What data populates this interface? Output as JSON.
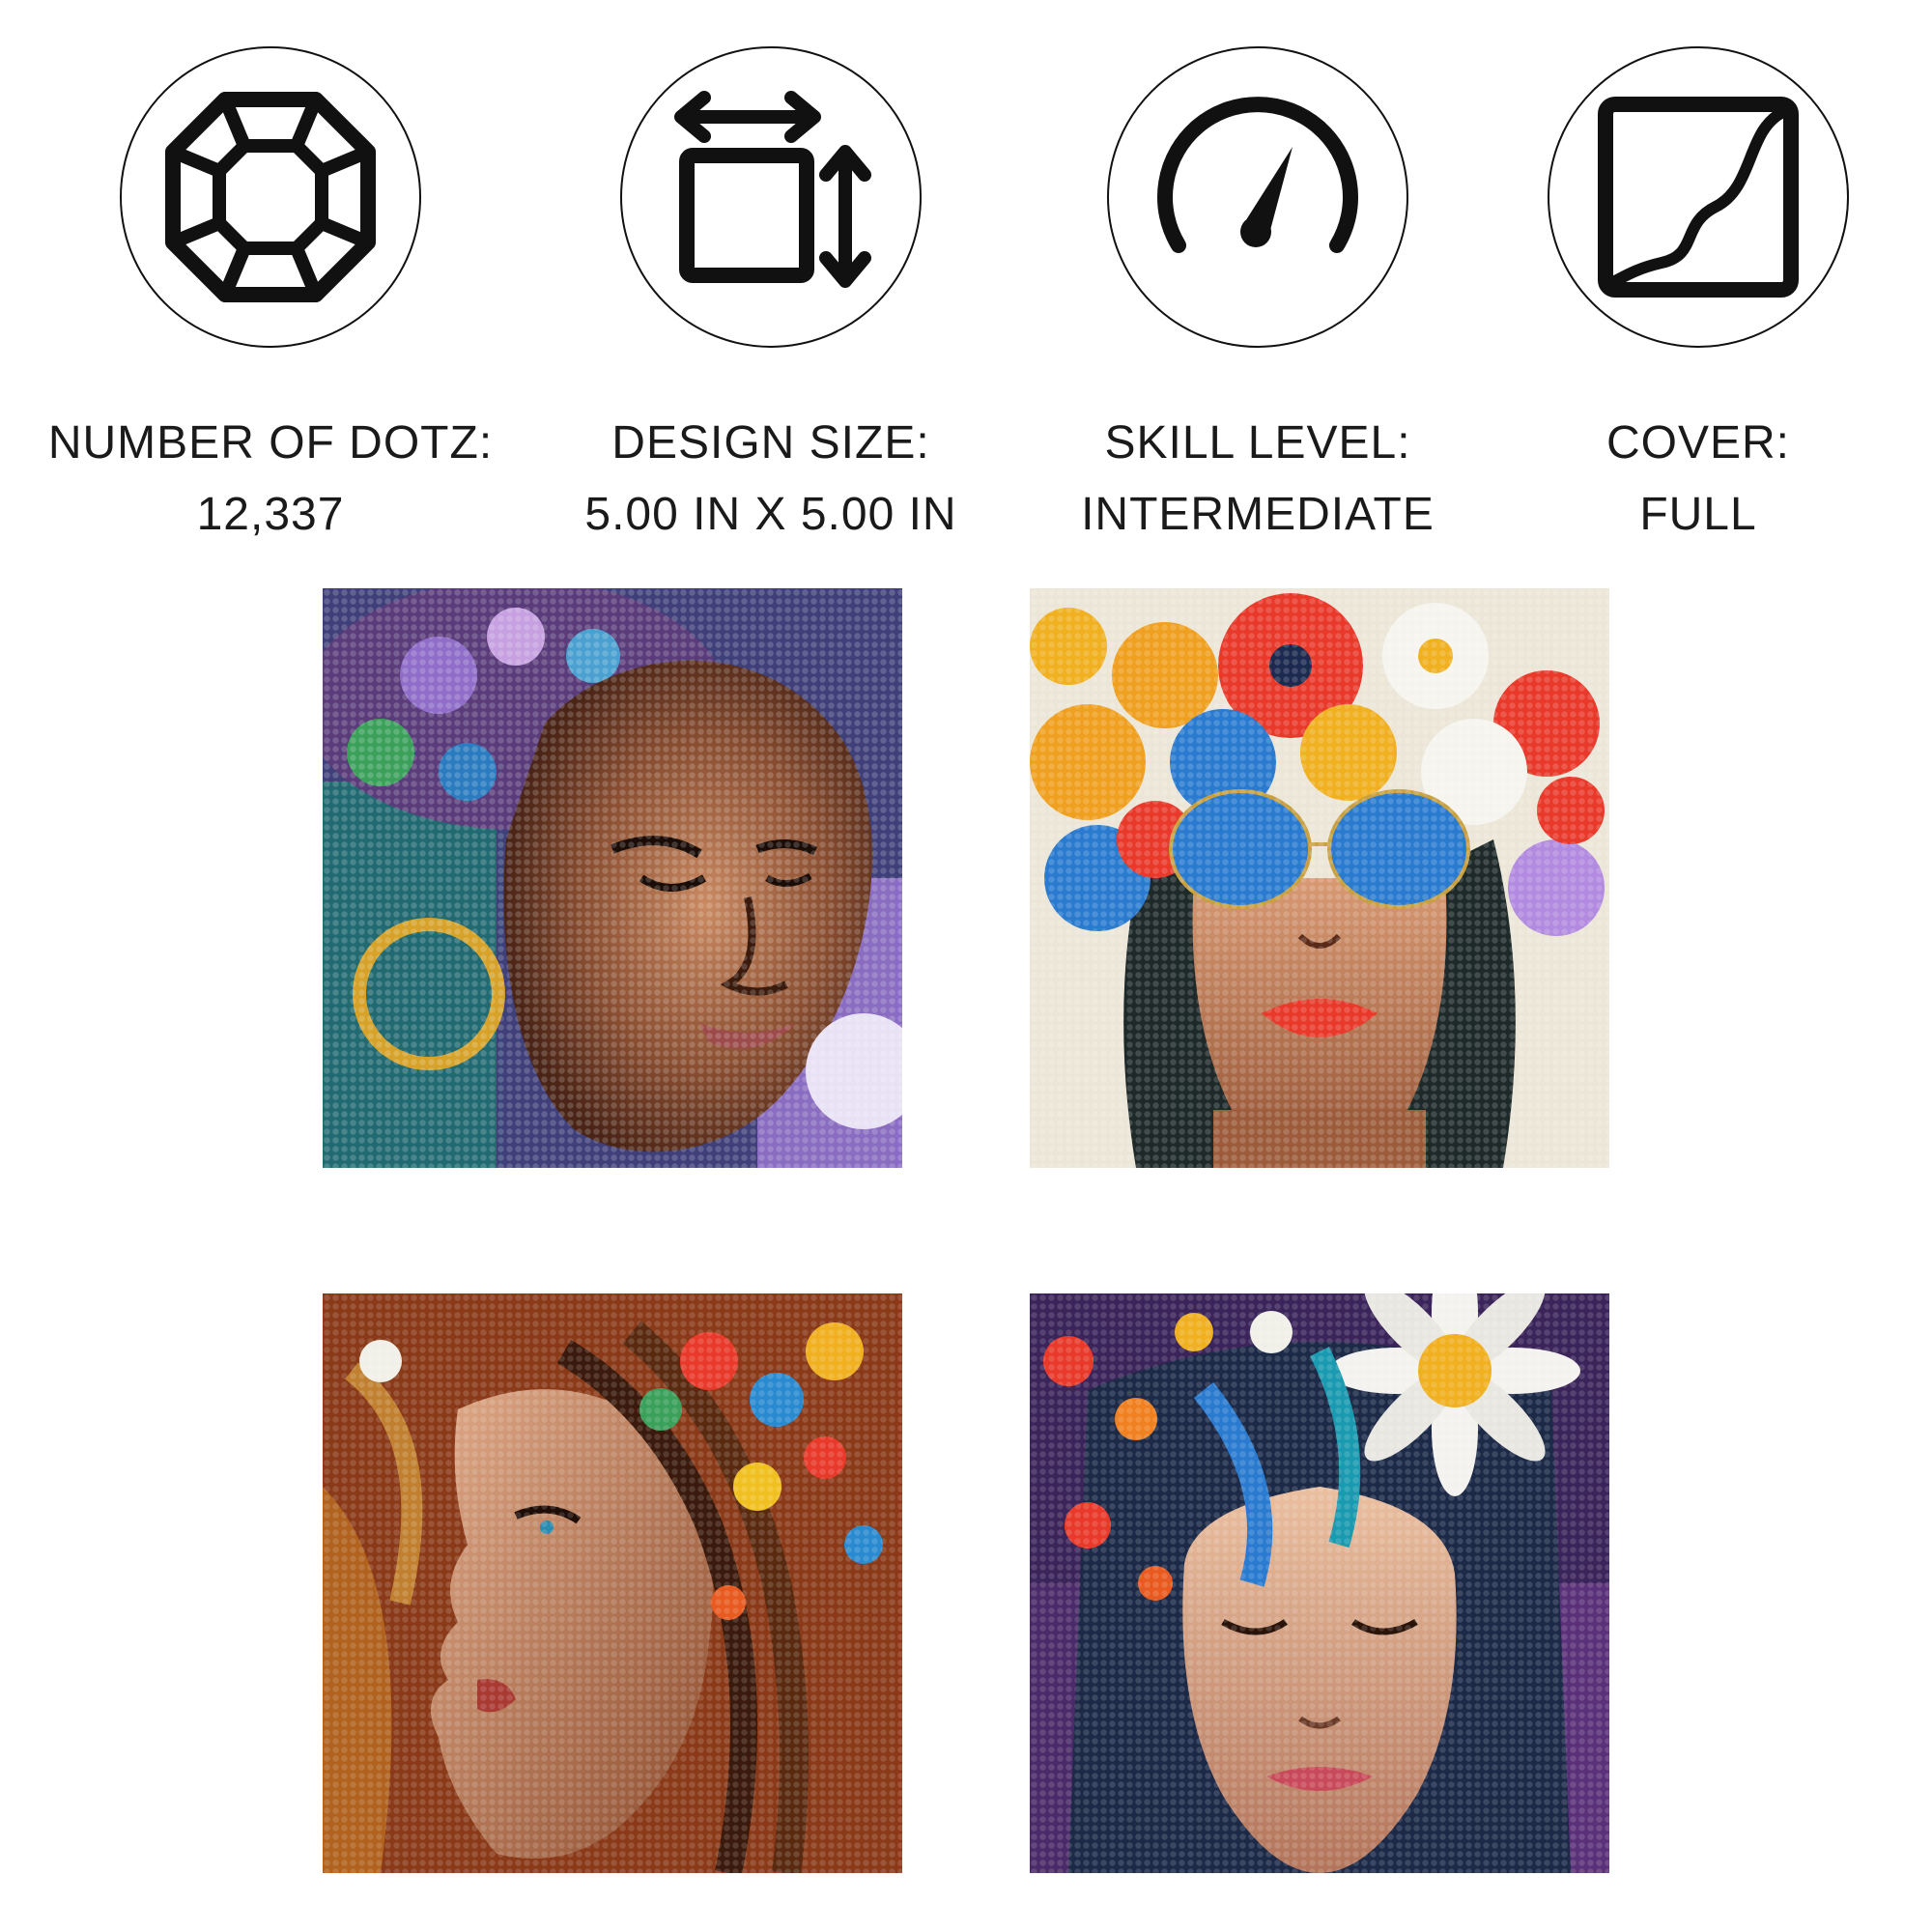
{
  "features": [
    {
      "icon": "gem-icon",
      "label": "NUMBER OF DOTZ:",
      "value": "12,337"
    },
    {
      "icon": "resize-icon",
      "label": "DESIGN SIZE:",
      "value": "5.00 IN X 5.00 IN"
    },
    {
      "icon": "speedometer-icon",
      "label": "SKILL LEVEL:",
      "value": "INTERMEDIATE"
    },
    {
      "icon": "cover-icon",
      "label": "COVER:",
      "value": "FULL"
    }
  ],
  "artworks": [
    {
      "name": "woman-with-hoop-earring-art"
    },
    {
      "name": "woman-with-flower-crown-sunglasses-art"
    },
    {
      "name": "woman-with-flowing-hair-profile-art"
    },
    {
      "name": "woman-with-daisy-headpiece-art"
    }
  ],
  "colors": {
    "icon_stroke": "#111111",
    "text": "#1a1a1a",
    "background": "#ffffff"
  }
}
